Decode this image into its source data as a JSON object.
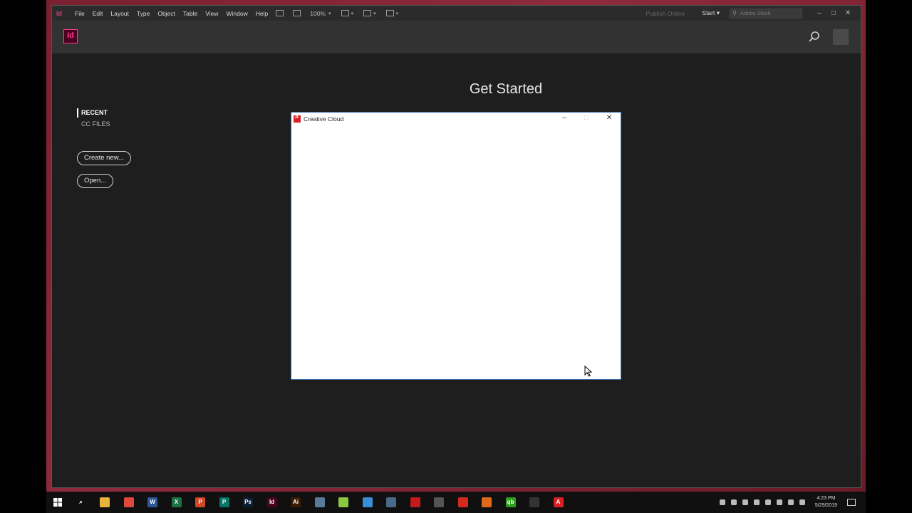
{
  "menubar": {
    "app_logo": "Id",
    "menus": [
      "File",
      "Edit",
      "Layout",
      "Type",
      "Object",
      "Table",
      "View",
      "Window",
      "Help"
    ],
    "tools": [
      "bridge-icon",
      "stock-icon"
    ],
    "zoom": "100%",
    "publish_label": "Publish Online",
    "workspace_label": "Start",
    "search_placeholder": "Adobe Stock"
  },
  "header": {
    "logo_text": "Id"
  },
  "main": {
    "title": "Get Started",
    "nav": {
      "recent": "RECENT",
      "cc_files": "CC FILES"
    },
    "create_label": "Create new...",
    "open_label": "Open..."
  },
  "dialog": {
    "title": "Creative Cloud"
  },
  "taskbar": {
    "apps": [
      {
        "name": "search",
        "color": "#101010",
        "glyph": "⌕"
      },
      {
        "name": "file-explorer",
        "color": "#e8b33a",
        "glyph": ""
      },
      {
        "name": "chrome",
        "color": "#e04a3a",
        "glyph": ""
      },
      {
        "name": "word",
        "color": "#2b5797",
        "glyph": "W"
      },
      {
        "name": "excel",
        "color": "#1e7145",
        "glyph": "X"
      },
      {
        "name": "powerpoint",
        "color": "#d24726",
        "glyph": "P"
      },
      {
        "name": "publisher",
        "color": "#077568",
        "glyph": "P"
      },
      {
        "name": "photoshop",
        "color": "#0a1f33",
        "glyph": "Ps"
      },
      {
        "name": "indesign",
        "color": "#49021f",
        "glyph": "Id"
      },
      {
        "name": "illustrator",
        "color": "#3a1a00",
        "glyph": "Ai"
      },
      {
        "name": "home-app",
        "color": "#5a7a9a",
        "glyph": ""
      },
      {
        "name": "numbers",
        "color": "#8dc63f",
        "glyph": ""
      },
      {
        "name": "globe",
        "color": "#3a8ed8",
        "glyph": ""
      },
      {
        "name": "remote-desktop",
        "color": "#4a6a8a",
        "glyph": ""
      },
      {
        "name": "acrobat-reader",
        "color": "#c41a1a",
        "glyph": ""
      },
      {
        "name": "calculator",
        "color": "#555",
        "glyph": ""
      },
      {
        "name": "settings-red",
        "color": "#d52b1e",
        "glyph": ""
      },
      {
        "name": "matlab",
        "color": "#e16a1a",
        "glyph": ""
      },
      {
        "name": "quickbooks",
        "color": "#2ca01c",
        "glyph": "qb"
      },
      {
        "name": "obs",
        "color": "#333",
        "glyph": ""
      },
      {
        "name": "creative-cloud",
        "color": "#da1f26",
        "glyph": "A"
      }
    ],
    "clock_time": "4:23 PM",
    "clock_date": "5/29/2019"
  }
}
